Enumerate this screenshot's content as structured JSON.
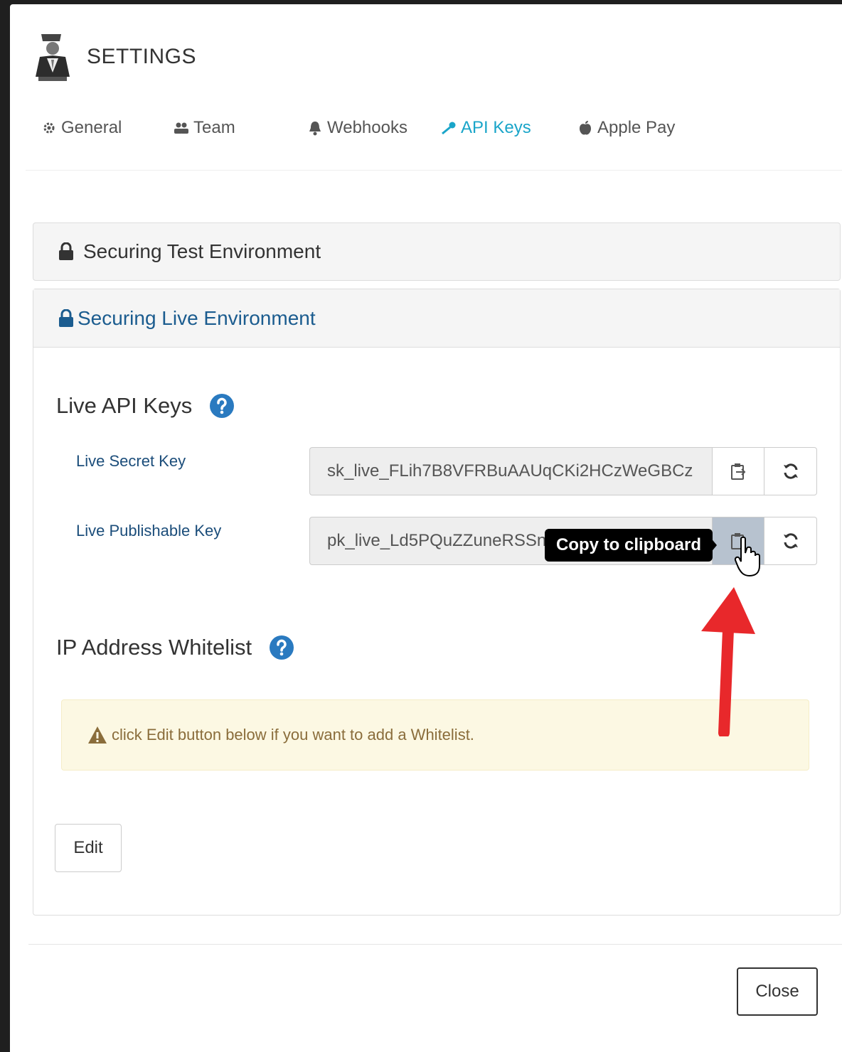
{
  "window": {
    "title": "SETTINGS"
  },
  "tabs": [
    {
      "label": "General",
      "icon": "gear-icon",
      "active": false
    },
    {
      "label": "Team",
      "icon": "team-icon",
      "active": false
    },
    {
      "label": "Webhooks",
      "icon": "bell-icon",
      "active": false
    },
    {
      "label": "API Keys",
      "icon": "key-icon",
      "active": true
    },
    {
      "label": "Apple Pay",
      "icon": "apple-icon",
      "active": false
    }
  ],
  "panels": {
    "test": {
      "title": "Securing Test Environment"
    },
    "live": {
      "title": "Securing Live Environment",
      "api_keys_title": "Live API Keys",
      "secret": {
        "label": "Live Secret Key",
        "value": "sk_live_FLih7B8VFRBuAAUqCKi2HCzWeGBCz"
      },
      "publishable": {
        "label": "Live Publishable Key",
        "value": "pk_live_Ld5PQuZZuneRSSn"
      },
      "tooltip": "Copy to clipboard",
      "whitelist_title": "IP Address Whitelist",
      "alert_text": "click Edit button below if you want to add a Whitelist.",
      "edit_label": "Edit"
    }
  },
  "footer": {
    "close_label": "Close"
  },
  "colors": {
    "active_tab": "#1aa5c9",
    "live_header": "#1b5c8f",
    "help_icon": "#2a7ac0",
    "annotation_arrow": "#e8282b",
    "alert_bg": "#fcf8e3"
  }
}
